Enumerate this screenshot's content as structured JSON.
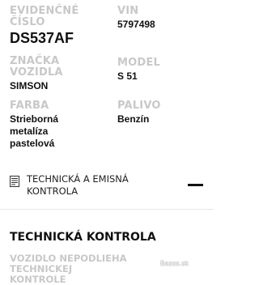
{
  "fields": {
    "evidencne_cislo": {
      "label": "EVIDENČNÉ\nČÍSLO",
      "value": "DS537AF"
    },
    "vin": {
      "label": "VIN",
      "value": "5797498"
    },
    "znacka": {
      "label": "ZNAČKA\nVOZIDLA",
      "value": "SIMSON"
    },
    "model": {
      "label": "MODEL",
      "value": "S 51"
    },
    "farba": {
      "label": "FARBA",
      "value": "Strieborná\nmetalíza\npastelová"
    },
    "palivo": {
      "label": "PALIVO",
      "value": "Benzín"
    }
  },
  "accordion": {
    "icon": "document-list-icon",
    "title": "TECHNICKÁ A EMISNÁ\nKONTROLA",
    "toggle_icon": "minus-collapse-icon"
  },
  "section": {
    "heading": "TECHNICKÁ KONTROLA",
    "status": "VOZIDLO NEPODLIEHA TECHNICKEJ\nKONTROLE"
  },
  "watermark": "Bazos.sk",
  "colors": {
    "label_gray": "#c8c8c8",
    "text_dark": "#111111",
    "background": "#ffffff"
  }
}
